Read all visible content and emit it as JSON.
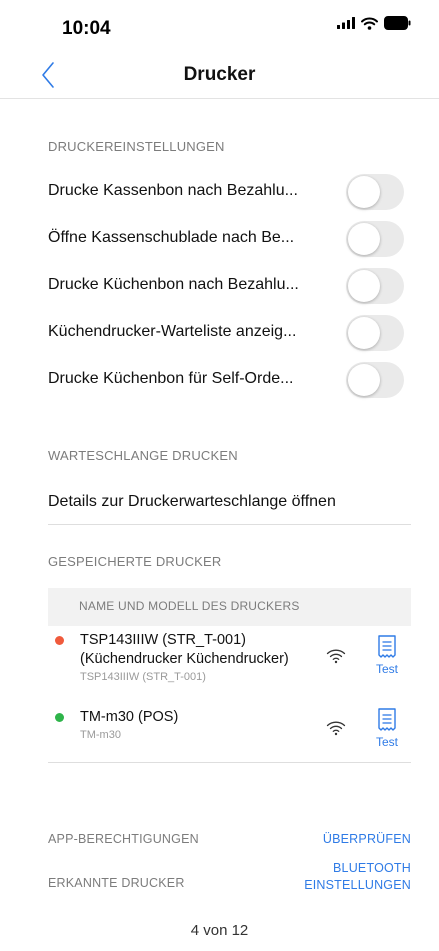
{
  "status_bar": {
    "time": "10:04"
  },
  "nav": {
    "title": "Drucker"
  },
  "printer_settings": {
    "header": "DRUCKEREINSTELLUNGEN",
    "toggles": [
      {
        "label": "Drucke Kassenbon nach Bezahlu...",
        "on": false
      },
      {
        "label": "Öffne Kassenschublade nach Be...",
        "on": false
      },
      {
        "label": "Drucke Küchenbon nach Bezahlu...",
        "on": false
      },
      {
        "label": "Küchendrucker-Warteliste anzeig...",
        "on": false
      },
      {
        "label": "Drucke Küchenbon für Self-Orde...",
        "on": false
      }
    ]
  },
  "print_queue": {
    "header": "WARTESCHLANGE DRUCKEN",
    "link": "Details zur Druckerwarteschlange öffnen"
  },
  "saved_printers": {
    "header": "GESPEICHERTE DRUCKER",
    "column_header": "NAME UND MODELL DES DRUCKERS",
    "printers": [
      {
        "name_line1": "TSP143IIIW (STR_T-001)",
        "name_line2": "(Küchendrucker Küchendrucker)",
        "model": "TSP143IIIW (STR_T-001)",
        "status_color": "#f05a3c",
        "test_label": "Test"
      },
      {
        "name_line1": "TM-m30 (POS)",
        "model": "TM-m30",
        "status_color": "#2eb44a",
        "test_label": "Test"
      }
    ]
  },
  "footer": {
    "app_permissions_label": "APP-BERECHTIGUNGEN",
    "app_permissions_action": "ÜBERPRÜFEN",
    "detected_printers_label": "ERKANNTE DRUCKER",
    "bluetooth_action_line1": "BLUETOOTH",
    "bluetooth_action_line2": "EINSTELLUNGEN"
  },
  "pager": {
    "text": "4 von 12"
  },
  "colors": {
    "accent": "#2f7be6",
    "toggle_off": "#eaeaea",
    "status_error": "#f05a3c",
    "status_ok": "#2eb44a"
  }
}
